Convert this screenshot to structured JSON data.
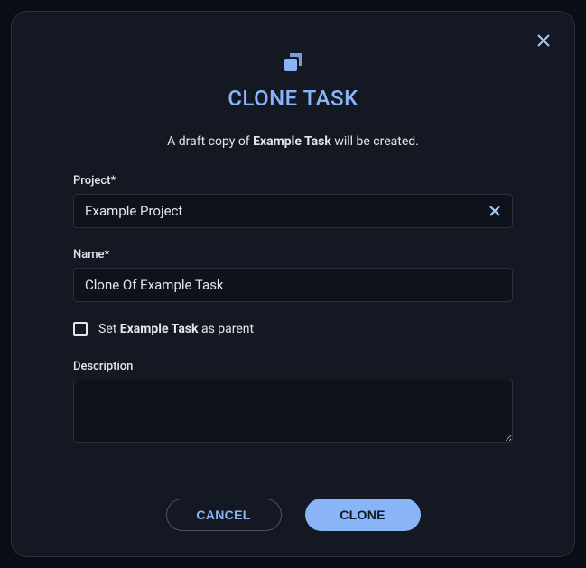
{
  "dialog": {
    "title": "CLONE TASK",
    "subtitle_prefix": "A draft copy of ",
    "subtitle_task": "Example Task",
    "subtitle_suffix": " will be created.",
    "project": {
      "label": "Project*",
      "value": "Example Project"
    },
    "name": {
      "label": "Name*",
      "value": "Clone Of Example Task"
    },
    "checkbox": {
      "prefix": "Set ",
      "task": "Example Task",
      "suffix": " as parent",
      "checked": false
    },
    "description": {
      "label": "Description",
      "value": ""
    },
    "buttons": {
      "cancel": "CANCEL",
      "clone": "CLONE"
    }
  }
}
